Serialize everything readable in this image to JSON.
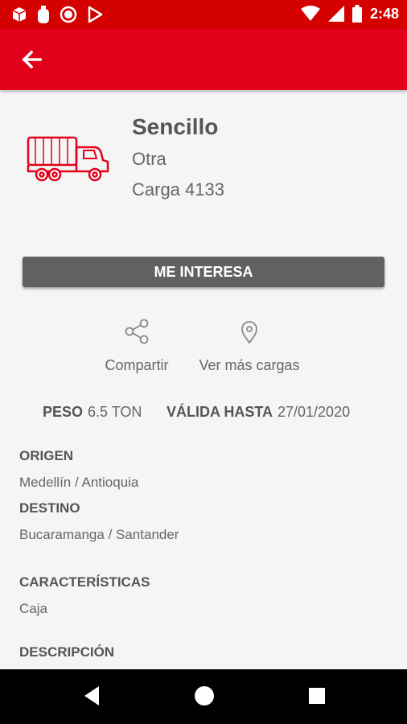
{
  "status_bar": {
    "time": "2:48",
    "left_icons": [
      "cube-icon",
      "bottle-icon",
      "record-icon",
      "play-store-icon"
    ],
    "right_icons": [
      "wifi-icon",
      "signal-icon",
      "battery-icon"
    ]
  },
  "app_bar": {
    "back_icon": "arrow-back-icon",
    "color": "#e2001a"
  },
  "load": {
    "icon": "truck-icon",
    "title": "Sencillo",
    "subtitle": "Otra",
    "code": "Carga 4133"
  },
  "cta": {
    "label": "ME INTERESA"
  },
  "actions": [
    {
      "label": "Compartir",
      "icon": "share-icon"
    },
    {
      "label": "Ver más cargas",
      "icon": "location-pin-icon"
    }
  ],
  "weight": {
    "label": "PESO",
    "value": "6.5 TON"
  },
  "valid_until": {
    "label": "VÁLIDA HASTA",
    "value": "27/01/2020"
  },
  "origin": {
    "label": "ORIGEN",
    "value": "Medellín / Antioquia"
  },
  "destination": {
    "label": "DESTINO",
    "value": "Bucaramanga / Santander"
  },
  "features": {
    "label": "CARACTERÍSTICAS",
    "value": "Caja"
  },
  "description": {
    "label": "DESCRIPCIÓN"
  },
  "nav_bar": {
    "icons": [
      "back-triangle-icon",
      "home-circle-icon",
      "recents-square-icon"
    ]
  }
}
